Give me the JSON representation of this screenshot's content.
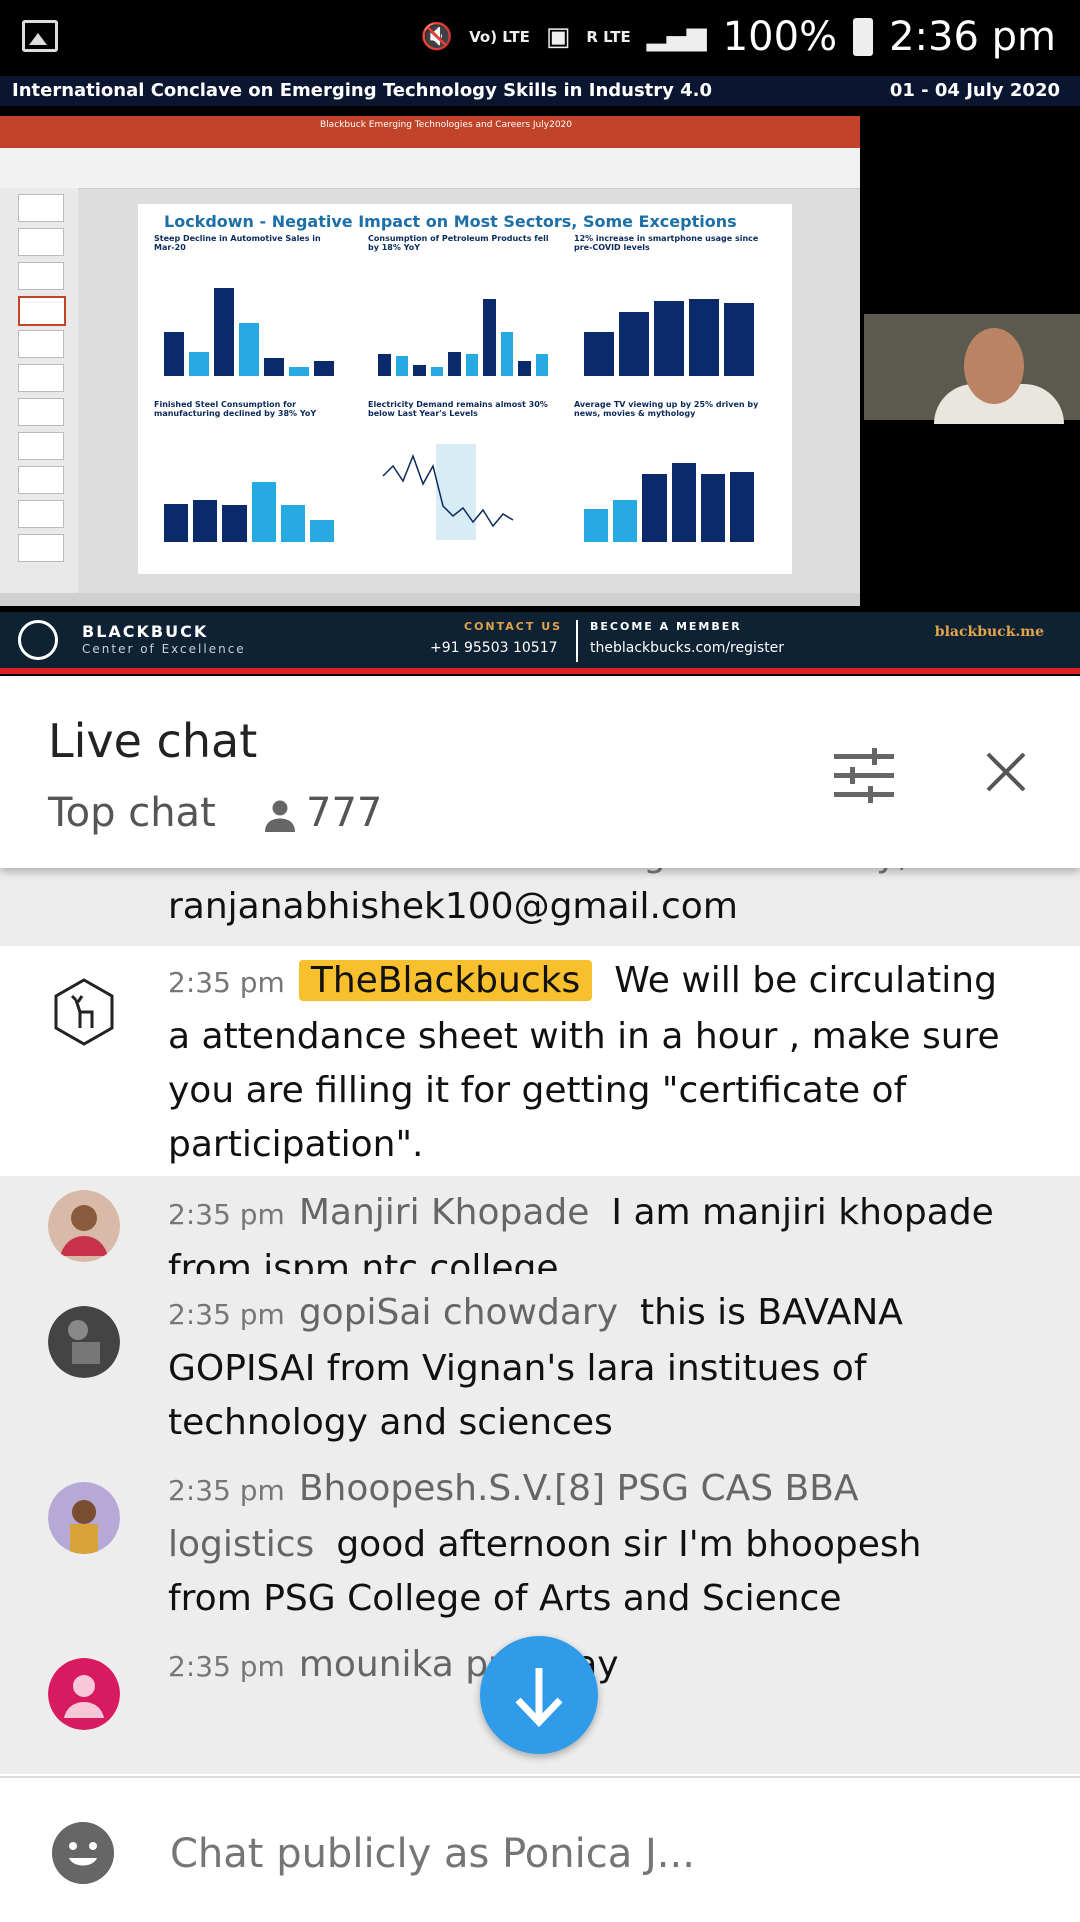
{
  "status_bar": {
    "net_labels": [
      "Vo) LTE",
      "R LTE"
    ],
    "battery": "100%",
    "time": "2:36 pm"
  },
  "video": {
    "conference_title": "International Conclave on Emerging Technology Skills in Industry 4.0",
    "conference_dates": "01 - 04 July 2020",
    "ppt_file_title": "Blackbuck Emerging Technologies and Careers July2020",
    "slide_heading": "Lockdown - Negative Impact on Most Sectors, Some Exceptions",
    "panels": [
      "Steep Decline in Automotive Sales in Mar-20",
      "Consumption of Petroleum Products fell by 18% YoY",
      "12% increase in smartphone usage since pre-COVID levels",
      "Finished Steel Consumption for manufacturing declined by 38% YoY",
      "Electricity Demand remains almost 30% below Last Year's Levels",
      "Average TV viewing up by 25% driven by news, movies & mythology"
    ],
    "brand_name": "BLACKBUCK",
    "brand_sub": "Center of Excellence",
    "contact_label": "CONTACT US",
    "contact_phone": "+91 95503 10517",
    "member_label": "BECOME A MEMBER",
    "member_url": "theblackbucks.com/register",
    "site": "blackbuck.me"
  },
  "chat_header": {
    "title": "Live chat",
    "mode": "Top chat",
    "viewers": "777"
  },
  "messages": [
    {
      "time": "",
      "author": "",
      "text": "ranjanabhishek100@gmail.com",
      "partial_top": "Institute of Business Management Policy,"
    },
    {
      "time": "2:35 pm",
      "author": "TheBlackbucks",
      "owner": true,
      "text": "We will be circulating a attendance sheet with in a hour , make sure you are filling it for getting \"certificate of participation\"."
    },
    {
      "time": "2:35 pm",
      "author": "Manjiri Khopade",
      "text": "I am manjiri khopade from jspm ntc college"
    },
    {
      "time": "2:35 pm",
      "author": "gopiSai chowdary",
      "text": "this is BAVANA GOPISAI from Vignan's lara institues of technology and sciences"
    },
    {
      "time": "2:35 pm",
      "author": "Bhoopesh.S.V.[8] PSG CAS BBA logistics",
      "text": "good afternoon sir I'm bhoopesh from PSG College of Arts and Science"
    },
    {
      "time": "2:35 pm",
      "author": "mounika pu",
      "text": "okay"
    }
  ],
  "input": {
    "placeholder": "Chat publicly as Ponica J..."
  },
  "colors": {
    "owner_badge": "#f8c02c",
    "fab": "#2f9be9",
    "brand_bar": "#0e2233",
    "ppt_header": "#c1432a"
  },
  "icons": [
    "gallery-icon",
    "mute-icon",
    "signal-icon",
    "battery-icon",
    "person-icon",
    "tune-icon",
    "close-icon",
    "arrow-down-icon",
    "emoji-icon"
  ]
}
